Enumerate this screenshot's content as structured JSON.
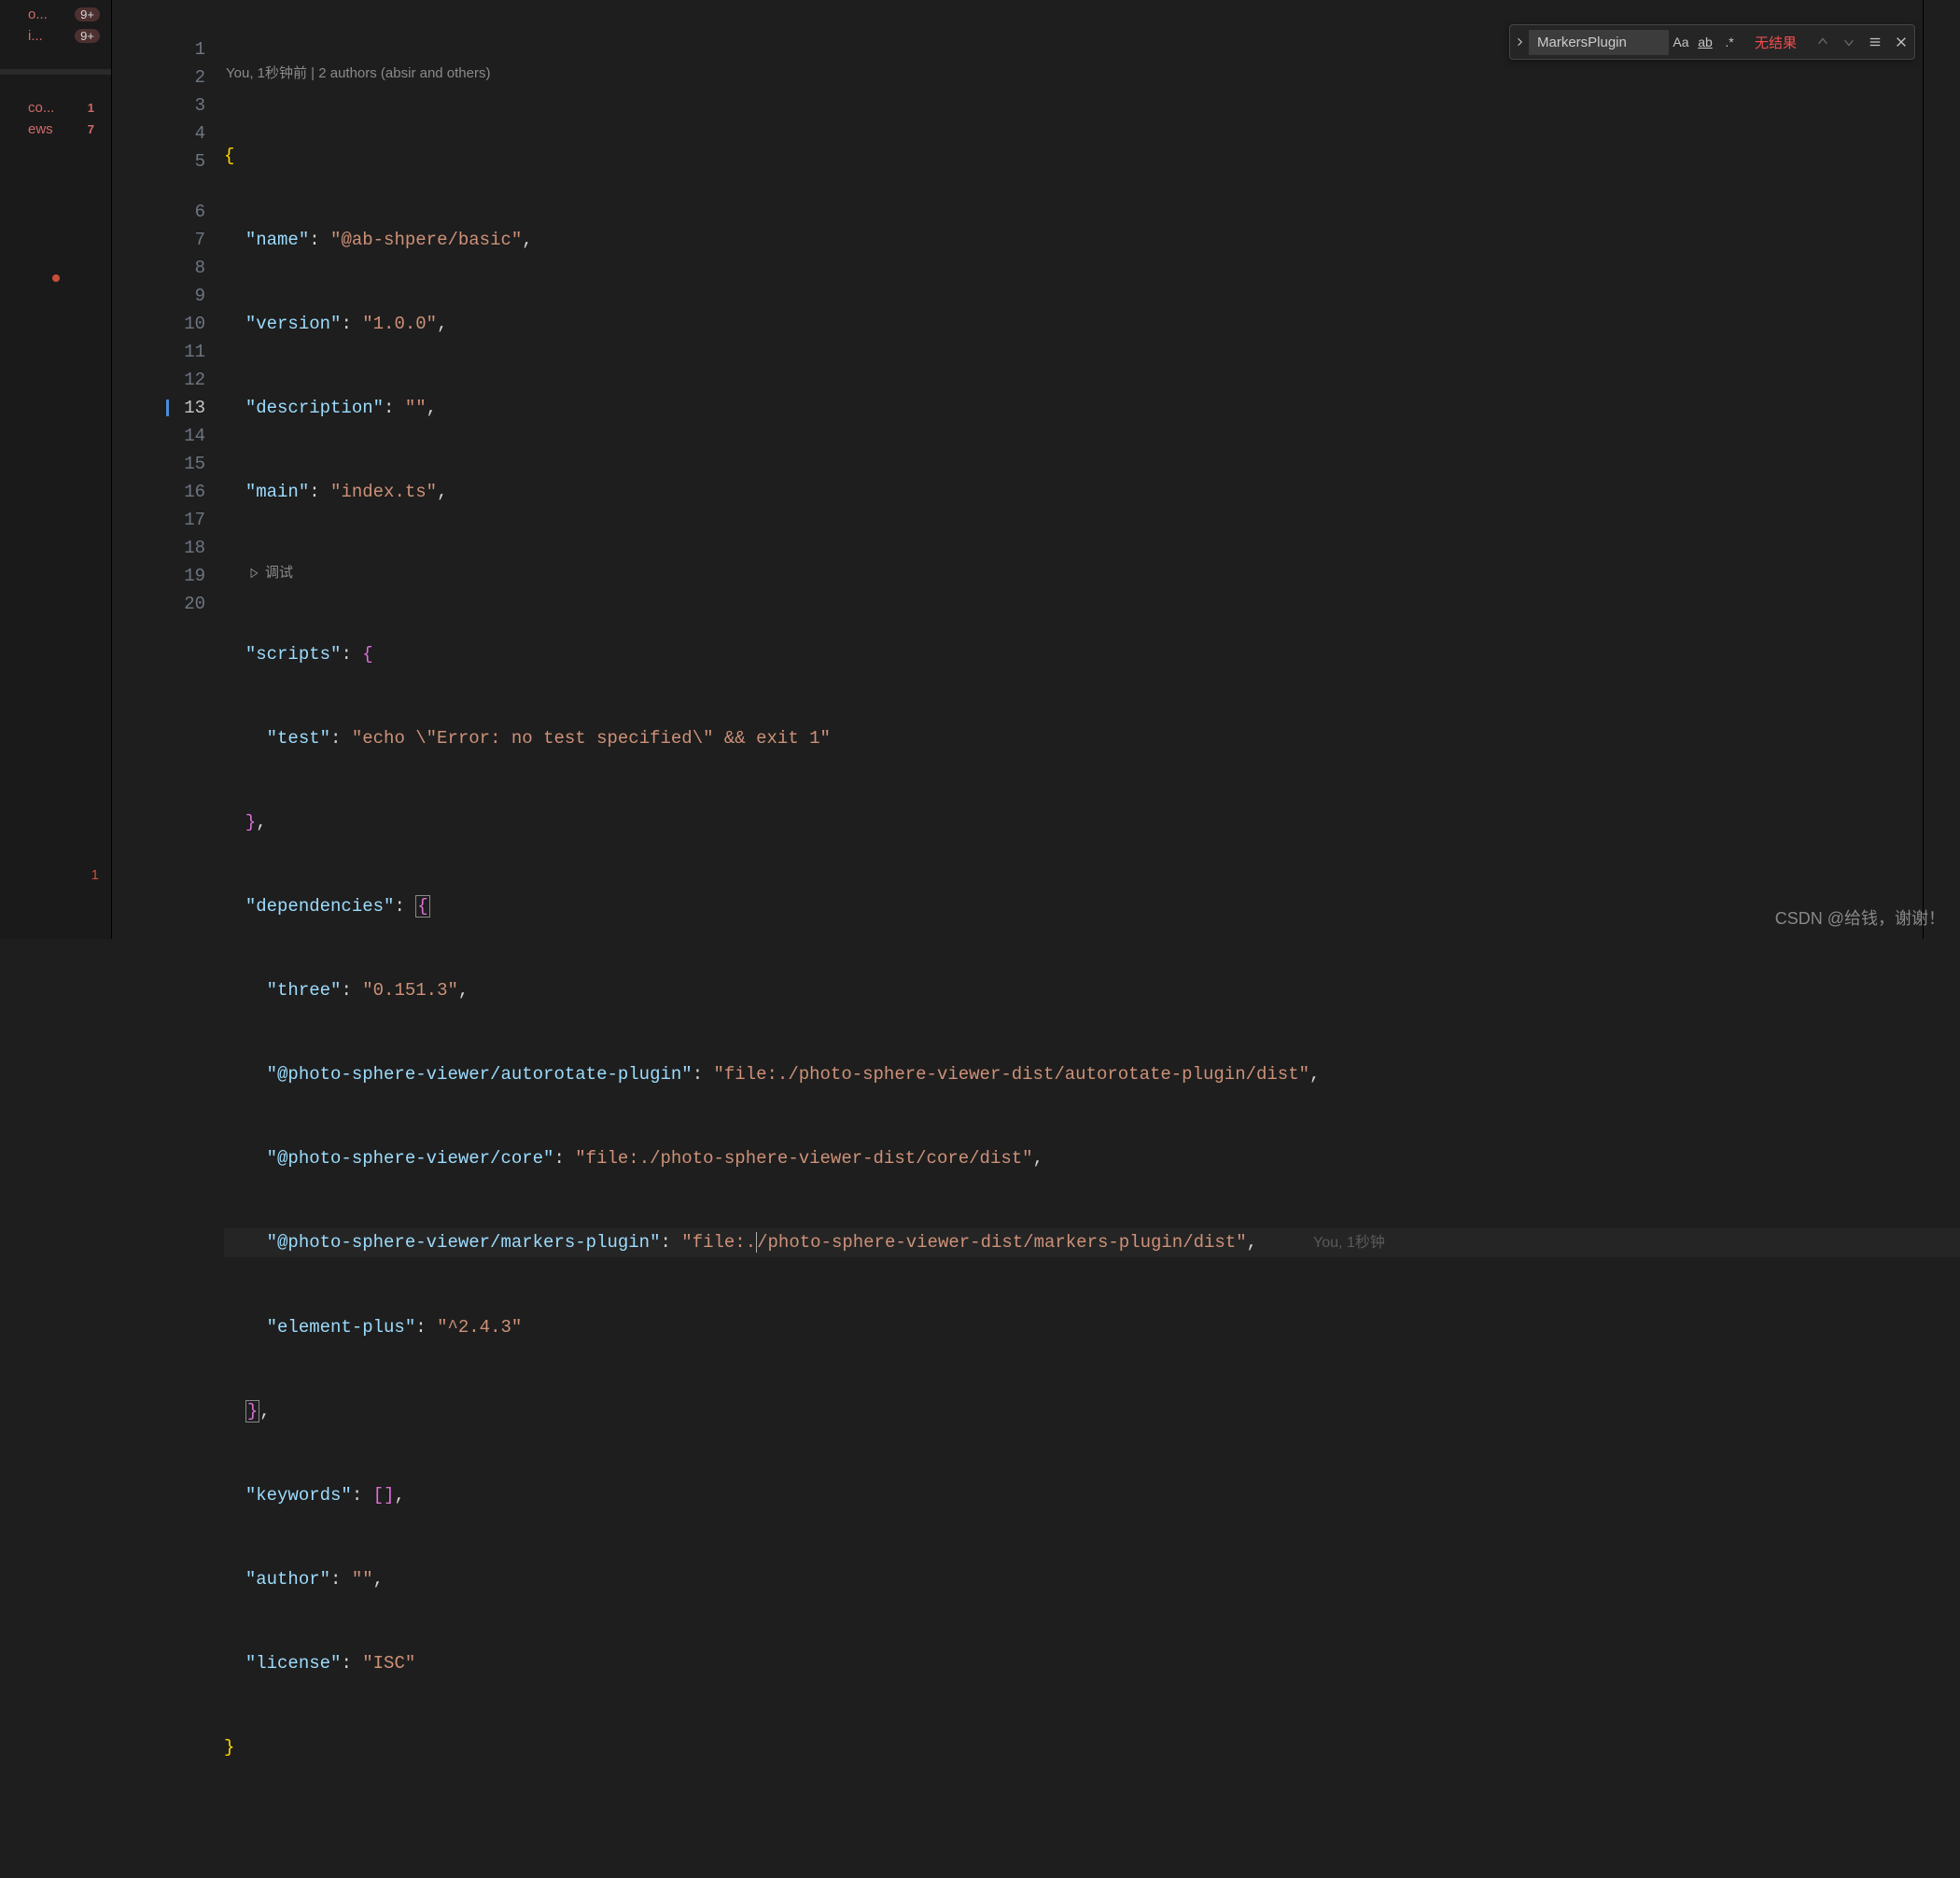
{
  "sidebar": {
    "items": [
      {
        "label": "o...",
        "badge": "9+"
      },
      {
        "label": "i...",
        "badge": "9+"
      },
      {
        "label": "",
        "badge": ""
      },
      {
        "label": "co...",
        "badge": "1"
      },
      {
        "label": "ews",
        "badge": "7"
      }
    ],
    "bottom_num": "1"
  },
  "codelens": "You, 1秒钟前 | 2 authors (absir and others)",
  "debug_label": "调试",
  "inline_blame": "You, 1秒钟",
  "lines": [
    "1",
    "2",
    "3",
    "4",
    "5",
    "6",
    "7",
    "8",
    "9",
    "10",
    "11",
    "12",
    "13",
    "14",
    "15",
    "16",
    "17",
    "18",
    "19",
    "20"
  ],
  "active_line": "13",
  "code": {
    "name_key": "\"name\"",
    "name_val": "\"@ab-shpere/basic\"",
    "version_key": "\"version\"",
    "version_val": "\"1.0.0\"",
    "description_key": "\"description\"",
    "description_val": "\"\"",
    "main_key": "\"main\"",
    "main_val": "\"index.ts\"",
    "scripts_key": "\"scripts\"",
    "test_key": "\"test\"",
    "test_val": "\"echo \\\"Error: no test specified\\\" && exit 1\"",
    "deps_key": "\"dependencies\"",
    "three_key": "\"three\"",
    "three_val": "\"0.151.3\"",
    "autorotate_key": "\"@photo-sphere-viewer/autorotate-plugin\"",
    "autorotate_val": "\"file:./photo-sphere-viewer-dist/autorotate-plugin/dist\"",
    "core_key": "\"@photo-sphere-viewer/core\"",
    "core_val": "\"file:./photo-sphere-viewer-dist/core/dist\"",
    "markers_key": "\"@photo-sphere-viewer/markers-plugin\"",
    "markers_val_a": "\"file:.",
    "markers_val_b": "/photo-sphere-viewer-dist/markers-plugin/dist\"",
    "elplus_key": "\"element-plus\"",
    "elplus_val": "\"^2.4.3\"",
    "keywords_key": "\"keywords\"",
    "author_key": "\"author\"",
    "author_val": "\"\"",
    "license_key": "\"license\"",
    "license_val": "\"ISC\""
  },
  "find": {
    "query": "MarkersPlugin",
    "case_label": "Aa",
    "word_label": "ab",
    "regex_label": ".*",
    "result": "无结果"
  },
  "watermark": "CSDN @给钱，谢谢！"
}
